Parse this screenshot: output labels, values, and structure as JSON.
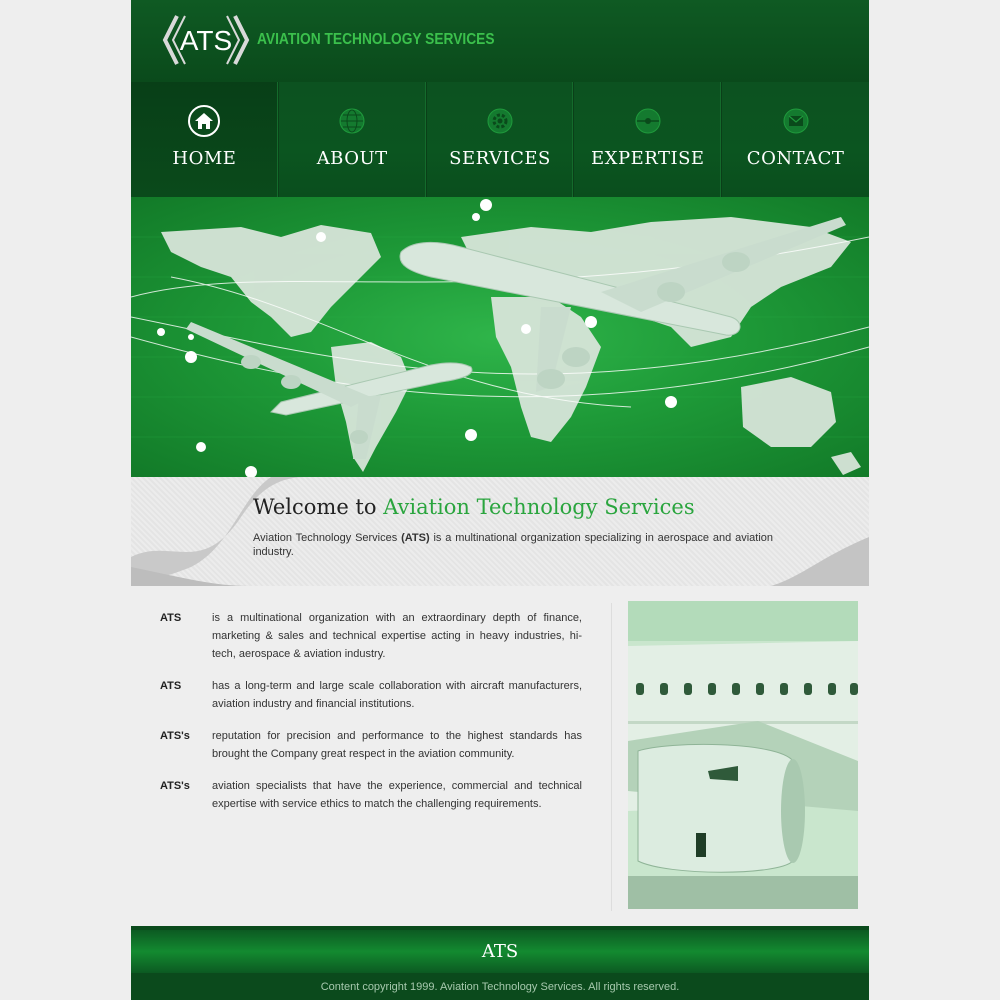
{
  "brand": {
    "logo_text": "ATS",
    "tagline": "AVIATION TECHNOLOGY SERVICES"
  },
  "nav": {
    "items": [
      {
        "label": "HOME",
        "icon": "home-icon",
        "active": true
      },
      {
        "label": "ABOUT",
        "icon": "globe-icon",
        "active": false
      },
      {
        "label": "SERVICES",
        "icon": "gear-icon",
        "active": false
      },
      {
        "label": "EXPERTISE",
        "icon": "target-icon",
        "active": false
      },
      {
        "label": "CONTACT",
        "icon": "mail-icon",
        "active": false
      }
    ]
  },
  "welcome": {
    "title_prefix": "Welcome to ",
    "title_accent": "Aviation Technology Services",
    "text_before": "Aviation Technology Services ",
    "text_bold": "(ATS)",
    "text_after": " is a multinational organization specializing in aerospace and aviation industry."
  },
  "content": {
    "rows": [
      {
        "key": "ATS",
        "text": "is a multinational organization with an extraordinary depth of finance, marketing & sales and technical expertise acting in heavy industries, hi-tech, aerospace & aviation industry."
      },
      {
        "key": "ATS",
        "text": "has a long-term and large scale collaboration with aircraft manufacturers, aviation industry and financial institutions."
      },
      {
        "key": "ATS's",
        "text": "reputation for precision and performance to the highest standards has brought the Company great respect in the aviation community."
      },
      {
        "key": "ATS's",
        "text": "aviation specialists that have the experience, commercial and technical expertise with service ethics to match the challenging requirements."
      }
    ]
  },
  "footer": {
    "title": "ATS",
    "copyright": "Content copyright 1999. Aviation Technology Services. All rights reserved."
  },
  "colors": {
    "accent": "#2aa53e",
    "header_dark": "#0a4a1b",
    "hero_green": "#1e9a38"
  }
}
